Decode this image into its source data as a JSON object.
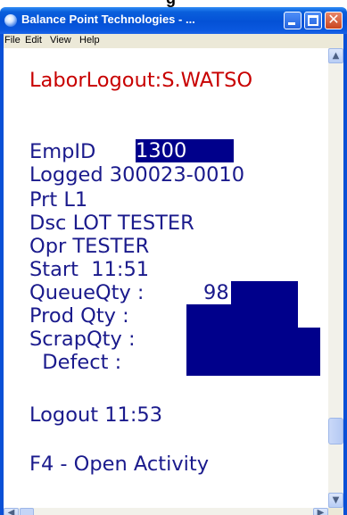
{
  "cropped_top_text": "g",
  "window": {
    "title": "Balance Point Technologies - ...",
    "minimize_symbol": "",
    "maximize_symbol": "",
    "close_symbol": "✕"
  },
  "menu": {
    "items": [
      "File",
      "Edit",
      "View",
      "Help"
    ]
  },
  "screen": {
    "header": "LaborLogout:S.WATSO",
    "emp_label": "EmpID  ",
    "emp_value": "1300",
    "logged_label": "Logged ",
    "logged_value": "300023-0010",
    "prt": "Prt L1",
    "dsc": "Dsc LOT TESTER",
    "opr": "Opr TESTER",
    "start": "Start  11:51",
    "queue_label": "QueueQty : ",
    "queue_value": "98",
    "prod_label": "Prod Qty :",
    "scrap_label": "ScrapQty :",
    "defect_label": "  Defect :",
    "logout": "Logout 11:53",
    "f4": "F4 - Open Activity"
  },
  "scrollbar": {
    "up_arrow": "▲",
    "down_arrow": "▼",
    "left_arrow": "◀",
    "right_arrow": "▶"
  }
}
